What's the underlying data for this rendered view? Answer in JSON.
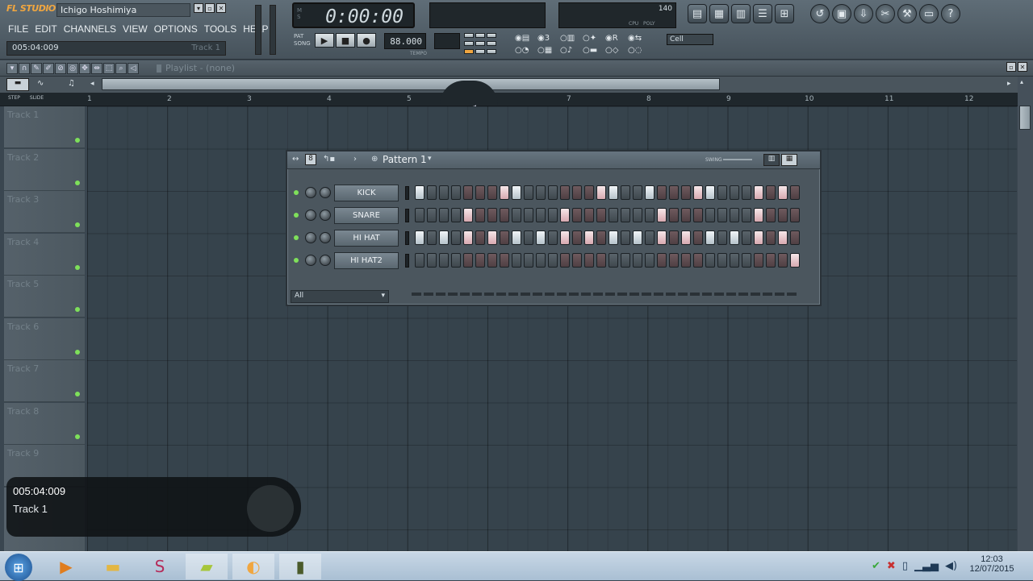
{
  "app": {
    "logo": "FL STUDIO",
    "project_title": "Ichigo Hoshimiya",
    "hint_time": "005:04:009",
    "hint_track": "Track 1"
  },
  "menu": [
    "FILE",
    "EDIT",
    "CHANNELS",
    "VIEW",
    "OPTIONS",
    "TOOLS",
    "HELP"
  ],
  "transport": {
    "time": "0:00:00",
    "tempo": "140",
    "tempo_label": "TEMPO",
    "bpm_display": "88.000",
    "pattern_label": "PAT",
    "song_label": "SONG",
    "cpu_label": "CPU",
    "poly_label": "POLY",
    "snap": "Cell"
  },
  "playlist": {
    "title": "Playlist - (none)",
    "ruler": [
      "1",
      "2",
      "3",
      "4",
      "5",
      "6",
      "7",
      "8",
      "9",
      "10",
      "11",
      "12"
    ],
    "tracks": [
      "Track 1",
      "Track 2",
      "Track 3",
      "Track 4",
      "Track 5",
      "Track 6",
      "Track 7",
      "Track 8",
      "Track 9"
    ],
    "step_label": "STEP",
    "slide_label": "SLIDE"
  },
  "channel_rack": {
    "title": "Pattern 1",
    "swing_label": "SWING",
    "filter": "All",
    "channels": [
      {
        "name": "KICK",
        "steps": [
          1,
          0,
          0,
          0,
          0,
          0,
          0,
          1,
          1,
          0,
          0,
          0,
          0,
          0,
          0,
          1,
          1,
          0,
          0,
          1,
          0,
          0,
          0,
          1,
          1,
          0,
          0,
          0,
          1,
          0,
          1,
          0
        ]
      },
      {
        "name": "SNARE",
        "steps": [
          0,
          0,
          0,
          0,
          1,
          0,
          0,
          0,
          0,
          0,
          0,
          0,
          1,
          0,
          0,
          0,
          0,
          0,
          0,
          0,
          1,
          0,
          0,
          0,
          0,
          0,
          0,
          0,
          1,
          0,
          0,
          0
        ]
      },
      {
        "name": "HI HAT",
        "steps": [
          1,
          0,
          1,
          0,
          1,
          0,
          1,
          0,
          1,
          0,
          1,
          0,
          1,
          0,
          1,
          0,
          1,
          0,
          1,
          0,
          1,
          0,
          1,
          0,
          1,
          0,
          1,
          0,
          1,
          0,
          1,
          0
        ]
      },
      {
        "name": "HI HAT2",
        "steps": [
          0,
          0,
          0,
          0,
          0,
          0,
          0,
          0,
          0,
          0,
          0,
          0,
          0,
          0,
          0,
          0,
          0,
          0,
          0,
          0,
          0,
          0,
          0,
          0,
          0,
          0,
          0,
          0,
          0,
          0,
          0,
          1
        ]
      }
    ]
  },
  "osd": {
    "time": "005:04:009",
    "track": "Track 1"
  },
  "tray": {
    "time": "12:03",
    "date": "12/07/2015"
  }
}
